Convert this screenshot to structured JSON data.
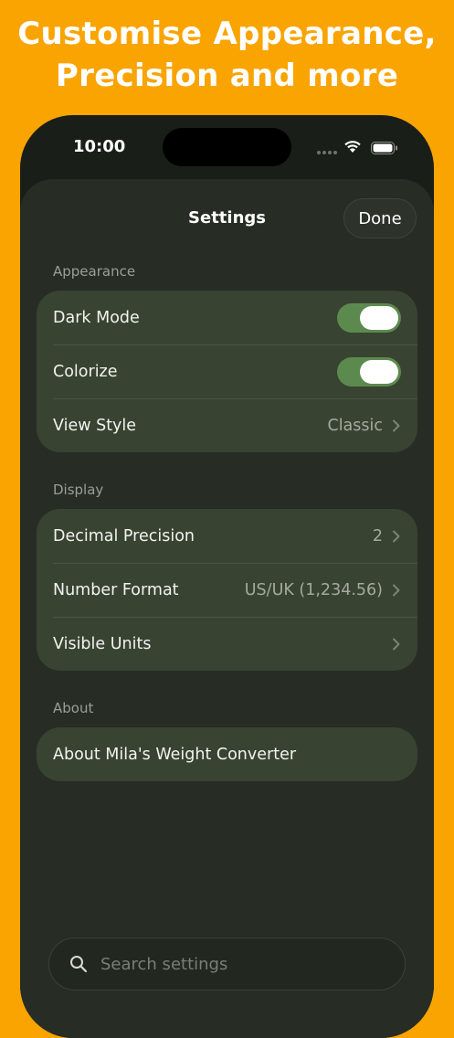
{
  "headline": {
    "line1": "Customise Appearance,",
    "line2": "Precision and more"
  },
  "status_bar": {
    "time": "10:00",
    "icons": [
      "signal-dots-icon",
      "wifi-icon",
      "battery-icon"
    ]
  },
  "sheet": {
    "title": "Settings",
    "done_label": "Done"
  },
  "sections": {
    "appearance": {
      "label": "Appearance",
      "dark_mode": {
        "label": "Dark Mode",
        "on": true
      },
      "colorize": {
        "label": "Colorize",
        "on": true
      },
      "view_style": {
        "label": "View Style",
        "value": "Classic"
      }
    },
    "display": {
      "label": "Display",
      "decimal_precision": {
        "label": "Decimal Precision",
        "value": "2"
      },
      "number_format": {
        "label": "Number Format",
        "value": "US/UK (1,234.56)"
      },
      "visible_units": {
        "label": "Visible Units"
      }
    },
    "about": {
      "label": "About",
      "about_app": {
        "label": "About Mila's Weight Converter"
      }
    }
  },
  "search": {
    "placeholder": "Search settings"
  },
  "colors": {
    "background": "#F9A400",
    "sheet": "#272C25",
    "group": "#384331",
    "toggle_on": "#5C8A4E",
    "text_primary": "#F2F3F0",
    "text_secondary": "#A5AAA0"
  }
}
